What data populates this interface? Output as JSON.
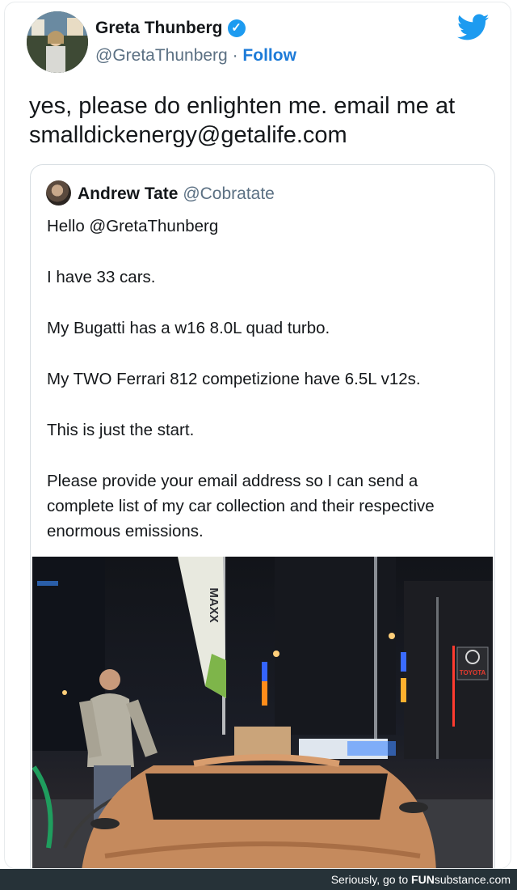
{
  "tweet": {
    "author_name": "Greta Thunberg",
    "author_handle": "@GretaThunberg",
    "separator": "·",
    "follow_label": "Follow",
    "text": "yes, please do enlighten me. email me at smalldickenergy@getalife.com",
    "verified_icon": "verified-badge-icon",
    "brand_icon": "twitter-bird-icon",
    "brand_color": "#1d9bf0"
  },
  "quoted_tweet": {
    "author_name": "Andrew Tate",
    "author_handle": "@Cobratate",
    "paragraphs": [
      "Hello @GretaThunberg",
      "I have 33 cars.",
      "My Bugatti has a w16 8.0L quad turbo.",
      "My TWO Ferrari 812 competizione have 6.5L v12s.",
      "This is just the start.",
      "Please provide your email address so I can send a complete list of my car collection and their respective enormous emissions."
    ],
    "photo_signs": {
      "banner": "MAXX",
      "brand": "TOYOTA"
    }
  },
  "footer": {
    "prefix": "Seriously, go to ",
    "site_bold": "FUN",
    "site_rest": "substance.com"
  }
}
